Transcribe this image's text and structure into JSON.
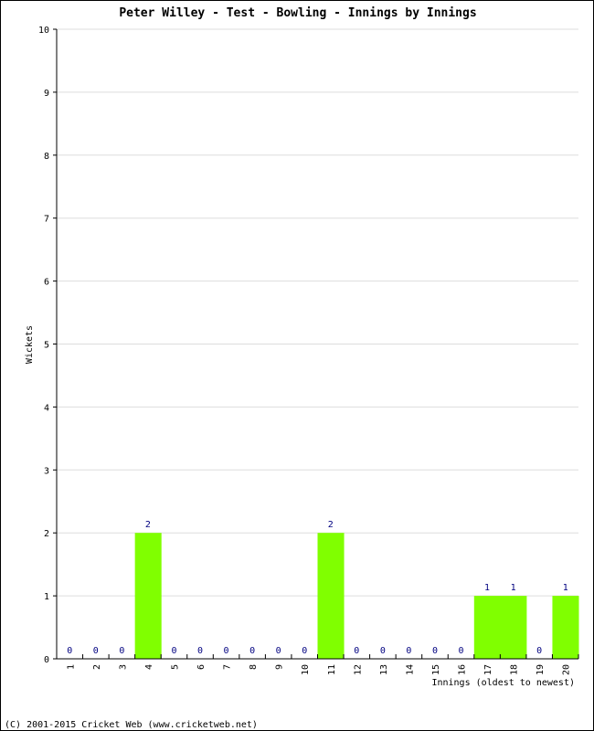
{
  "chart_data": {
    "type": "bar",
    "title": "Peter Willey - Test - Bowling - Innings by Innings",
    "xlabel": "Innings (oldest to newest)",
    "ylabel": "Wickets",
    "ylim": [
      0,
      10
    ],
    "yticks": [
      "0",
      "1",
      "2",
      "3",
      "4",
      "5",
      "6",
      "7",
      "8",
      "9",
      "10"
    ],
    "grid": true,
    "categories": [
      "1",
      "2",
      "3",
      "4",
      "5",
      "6",
      "7",
      "8",
      "9",
      "10",
      "11",
      "12",
      "13",
      "14",
      "15",
      "16",
      "17",
      "18",
      "19",
      "20"
    ],
    "values": [
      0,
      0,
      0,
      2,
      0,
      0,
      0,
      0,
      0,
      0,
      2,
      0,
      0,
      0,
      0,
      0,
      1,
      1,
      0,
      1
    ],
    "bar_color": "#80ff00",
    "label_color": "#000080"
  },
  "footer": "(C) 2001-2015 Cricket Web (www.cricketweb.net)"
}
